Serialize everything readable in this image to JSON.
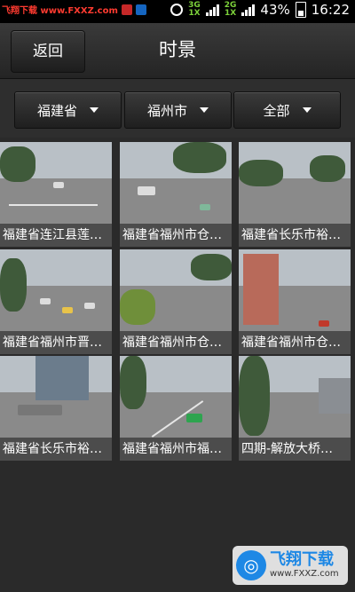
{
  "status_bar": {
    "site": "飞翔下载 www.FXXZ.com",
    "net_top": "3G",
    "net_bottom": "1X",
    "net2_top": "2G",
    "net2_bottom": "1X",
    "battery": "43%",
    "time": "16:22"
  },
  "header": {
    "back_label": "返回",
    "title": "时景"
  },
  "filters": {
    "province": "福建省",
    "city": "福州市",
    "scope": "全部"
  },
  "cameras": [
    "福建省连江县莲…",
    "福建省福州市仓…",
    "福建省长乐市裕…",
    "福建省福州市晋…",
    "福建省福州市仓…",
    "福建省福州市仓…",
    "福建省长乐市裕…",
    "福建省福州市福…",
    "四期-解放大桥…"
  ],
  "watermark": {
    "name": "飞翔下载",
    "url": "www.FXXZ.com"
  },
  "colors": {
    "background": "#2a2a2a",
    "title_bar": "#2e2e2e",
    "status_bar": "#000000"
  }
}
